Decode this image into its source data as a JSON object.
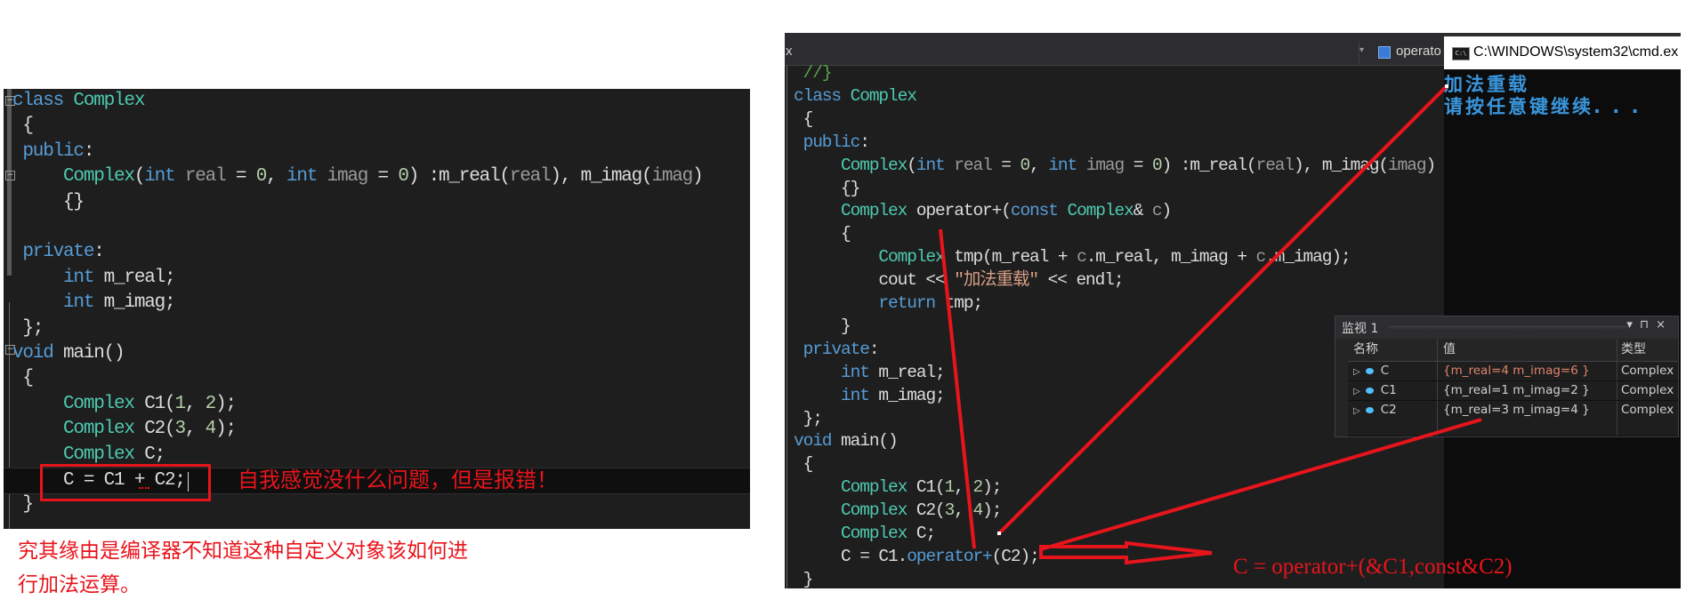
{
  "left_editor": {
    "lines": [
      [
        [
          "kw",
          "class"
        ],
        [
          "fn",
          " "
        ],
        [
          "ty",
          "Complex"
        ]
      ],
      [
        [
          "fn",
          " {"
        ]
      ],
      [
        [
          "kw",
          " public"
        ],
        [
          "fn",
          ":"
        ]
      ],
      [
        [
          "fn",
          "     "
        ],
        [
          "ty",
          "Complex"
        ],
        [
          "fn",
          "("
        ],
        [
          "kw",
          "int"
        ],
        [
          "pm",
          " real"
        ],
        [
          "fn",
          " = "
        ],
        [
          "num",
          "0"
        ],
        [
          "fn",
          ", "
        ],
        [
          "kw",
          "int"
        ],
        [
          "pm",
          " imag"
        ],
        [
          "fn",
          " = "
        ],
        [
          "num",
          "0"
        ],
        [
          "fn",
          ") :m_real("
        ],
        [
          "pm",
          "real"
        ],
        [
          "fn",
          "), m_imag("
        ],
        [
          "pm",
          "imag"
        ],
        [
          "fn",
          ")"
        ]
      ],
      [
        [
          "fn",
          "     {}"
        ]
      ],
      [
        [
          "fn",
          ""
        ]
      ],
      [
        [
          "kw",
          " private"
        ],
        [
          "fn",
          ":"
        ]
      ],
      [
        [
          "fn",
          "     "
        ],
        [
          "kw",
          "int"
        ],
        [
          "fn",
          " m_real;"
        ]
      ],
      [
        [
          "fn",
          "     "
        ],
        [
          "kw",
          "int"
        ],
        [
          "fn",
          " m_imag;"
        ]
      ],
      [
        [
          "fn",
          " };"
        ]
      ],
      [
        [
          "kw",
          "void"
        ],
        [
          "fn",
          " main()"
        ]
      ],
      [
        [
          "fn",
          " {"
        ]
      ],
      [
        [
          "fn",
          "     "
        ],
        [
          "ty",
          "Complex"
        ],
        [
          "fn",
          " C1("
        ],
        [
          "num",
          "1"
        ],
        [
          "fn",
          ", "
        ],
        [
          "num",
          "2"
        ],
        [
          "fn",
          ");"
        ]
      ],
      [
        [
          "fn",
          "     "
        ],
        [
          "ty",
          "Complex"
        ],
        [
          "fn",
          " C2("
        ],
        [
          "num",
          "3"
        ],
        [
          "fn",
          ", "
        ],
        [
          "num",
          "4"
        ],
        [
          "fn",
          ");"
        ]
      ],
      [
        [
          "fn",
          "     "
        ],
        [
          "ty",
          "Complex"
        ],
        [
          "fn",
          " C;"
        ]
      ],
      [
        [
          "fn",
          "     C = C1 + C2;"
        ]
      ],
      [
        [
          "fn",
          " }"
        ]
      ]
    ],
    "current_line": 15,
    "annotation_inline": "自我感觉没什么问题，但是报错！",
    "annotation_below_1": "究其缘由是编译器不知道这种自定义对象该如何进",
    "annotation_below_2": "行加法运算。"
  },
  "right_editor": {
    "toolbar": {
      "close_label": "x",
      "member_label": "operato"
    },
    "lines": [
      [
        [
          "cm",
          " //}"
        ]
      ],
      [
        [
          "kw",
          "class"
        ],
        [
          "fn",
          " "
        ],
        [
          "ty",
          "Complex"
        ]
      ],
      [
        [
          "fn",
          " {"
        ]
      ],
      [
        [
          "kw",
          " public"
        ],
        [
          "fn",
          ":"
        ]
      ],
      [
        [
          "fn",
          "     "
        ],
        [
          "ty",
          "Complex"
        ],
        [
          "fn",
          "("
        ],
        [
          "kw",
          "int"
        ],
        [
          "pm",
          " real"
        ],
        [
          "fn",
          " = "
        ],
        [
          "num",
          "0"
        ],
        [
          "fn",
          ", "
        ],
        [
          "kw",
          "int"
        ],
        [
          "pm",
          " imag"
        ],
        [
          "fn",
          " = "
        ],
        [
          "num",
          "0"
        ],
        [
          "fn",
          ") :m_real("
        ],
        [
          "pm",
          "real"
        ],
        [
          "fn",
          "), m_imag("
        ],
        [
          "pm",
          "imag"
        ],
        [
          "fn",
          ")"
        ]
      ],
      [
        [
          "fn",
          "     {}"
        ]
      ],
      [
        [
          "fn",
          "     "
        ],
        [
          "ty",
          "Complex"
        ],
        [
          "fn",
          " operator+("
        ],
        [
          "kw",
          "const"
        ],
        [
          "fn",
          " "
        ],
        [
          "ty",
          "Complex"
        ],
        [
          "fn",
          "& "
        ],
        [
          "pm",
          "c"
        ],
        [
          "fn",
          ")"
        ]
      ],
      [
        [
          "fn",
          "     {"
        ]
      ],
      [
        [
          "fn",
          "         "
        ],
        [
          "ty",
          "Complex"
        ],
        [
          "fn",
          " tmp(m_real + "
        ],
        [
          "pm",
          "c"
        ],
        [
          "fn",
          ".m_real, m_imag + "
        ],
        [
          "pm",
          "c"
        ],
        [
          "fn",
          ".m_imag);"
        ]
      ],
      [
        [
          "fn",
          "         cout << "
        ],
        [
          "str",
          "\"加法重载\""
        ],
        [
          "fn",
          " << endl;"
        ]
      ],
      [
        [
          "fn",
          "         "
        ],
        [
          "kw",
          "return"
        ],
        [
          "fn",
          " tmp;"
        ]
      ],
      [
        [
          "fn",
          "     }"
        ]
      ],
      [
        [
          "kw",
          " private"
        ],
        [
          "fn",
          ":"
        ]
      ],
      [
        [
          "fn",
          "     "
        ],
        [
          "kw",
          "int"
        ],
        [
          "fn",
          " m_real;"
        ]
      ],
      [
        [
          "fn",
          "     "
        ],
        [
          "kw",
          "int"
        ],
        [
          "fn",
          " m_imag;"
        ]
      ],
      [
        [
          "fn",
          " };"
        ]
      ],
      [
        [
          "kw",
          "void"
        ],
        [
          "fn",
          " main()"
        ]
      ],
      [
        [
          "fn",
          " {"
        ]
      ],
      [
        [
          "fn",
          "     "
        ],
        [
          "ty",
          "Complex"
        ],
        [
          "fn",
          " C1("
        ],
        [
          "num",
          "1"
        ],
        [
          "fn",
          ", "
        ],
        [
          "num",
          "2"
        ],
        [
          "fn",
          ");"
        ]
      ],
      [
        [
          "fn",
          "     "
        ],
        [
          "ty",
          "Complex"
        ],
        [
          "fn",
          " C2("
        ],
        [
          "num",
          "3"
        ],
        [
          "fn",
          ", "
        ],
        [
          "num",
          "4"
        ],
        [
          "fn",
          ");"
        ]
      ],
      [
        [
          "fn",
          "     "
        ],
        [
          "ty",
          "Complex"
        ],
        [
          "fn",
          " C;"
        ]
      ],
      [
        [
          "fn",
          "     C = C1."
        ],
        [
          "op",
          "operator+"
        ],
        [
          "fn",
          "(C2);"
        ]
      ],
      [
        [
          "fn",
          " }"
        ]
      ]
    ],
    "annotation": "C = operator+(&C1,const&C2)"
  },
  "console": {
    "title": "C:\\WINDOWS\\system32\\cmd.ex",
    "icon": "cmd-icon",
    "output": [
      "加法重载",
      "请按任意键继续. . ."
    ]
  },
  "watch": {
    "title": "监视 1",
    "buttons": [
      "▾",
      "⊓",
      "×"
    ],
    "columns": [
      "名称",
      "值",
      "类型"
    ],
    "rows": [
      {
        "name": "C",
        "value": "{m_real=4 m_imag=6 }",
        "type": "Complex",
        "changed": true
      },
      {
        "name": "C1",
        "value": "{m_real=1 m_imag=2 }",
        "type": "Complex",
        "changed": false
      },
      {
        "name": "C2",
        "value": "{m_real=3 m_imag=4 }",
        "type": "Complex",
        "changed": false
      }
    ]
  },
  "colors": {
    "annotation_red": "#e8141c",
    "changed_value": "#e0836a",
    "console_text": "#3a96dd"
  }
}
